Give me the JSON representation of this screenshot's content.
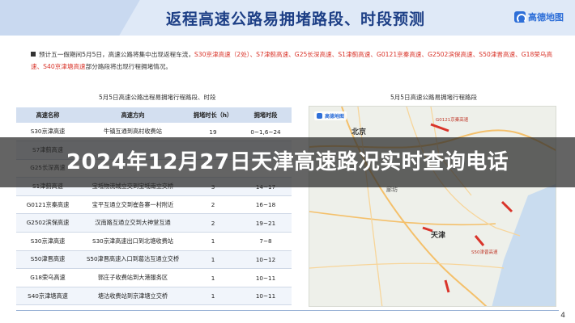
{
  "header": {
    "title": "返程高速公路易拥堵路段、时段预测",
    "logo_text": "高德地图",
    "logo_icon": "gaode-logo-icon"
  },
  "notice": {
    "prefix": "预计五一假期间5月5日，高速公路将集中出现返程车流，",
    "highlighted": "S30京津高速（2处）、S7津蓟高速、G25长深高速、S1津蓟高速、G0121京秦高速、G2502滨保高速、S50津晋高速、G18荣乌高速、S40京津塘高速",
    "suffix": "部分路段将出现行程拥堵情况。"
  },
  "table": {
    "title": "5月5日高速公路出程易拥堵行程路段、时段",
    "headers": [
      "高速名称",
      "高速方向",
      "拥堵时长（h）",
      "拥堵时段"
    ],
    "rows": [
      [
        "S30京津高速",
        "牛镇互通到高村收费站",
        "19",
        "0~1,6~24"
      ],
      [
        "S7津蓟高速",
        "",
        "",
        ""
      ],
      [
        "G25长深高速",
        "",
        "",
        ""
      ],
      [
        "S1津蓟高速",
        "宝坻物流城立交到宝坻南立交桥",
        "3",
        "14~17"
      ],
      [
        "G0121京秦高速",
        "宝平互通立交到崔各寨一村附近",
        "2",
        "16~18"
      ],
      [
        "G2502滨保高速",
        "汉南路互通立交到大神堂互通",
        "2",
        "19~21"
      ],
      [
        "S30京津高速",
        "S30京津高速出口到北塘收费站",
        "1",
        "7~8"
      ],
      [
        "S50津晋高速",
        "S50津晋高速入口到葛沽互通立交桥",
        "1",
        "10~12"
      ],
      [
        "G18荣乌高速",
        "郭庄子收费站到大港服务区",
        "1",
        "10~11"
      ],
      [
        "S40京津塘高速",
        "塘沽收费站到京津塘立交桥",
        "1",
        "10~11"
      ]
    ]
  },
  "map": {
    "title": "5月5日高速公路易拥堵行程路段",
    "brand": "高德地图",
    "cities": [
      "北京",
      "廊坊",
      "天津"
    ],
    "road_tags": [
      "G0121京秦高速",
      "S50津晋高速"
    ],
    "colors": {
      "land": "#eef0ea",
      "sea": "#c9dcef",
      "road": "#f4c06b",
      "congestion": "#d9342a"
    }
  },
  "overlay": {
    "title": "2024年12月27日天津高速路况实时查询电话"
  },
  "footer": {
    "page_number": "4"
  }
}
